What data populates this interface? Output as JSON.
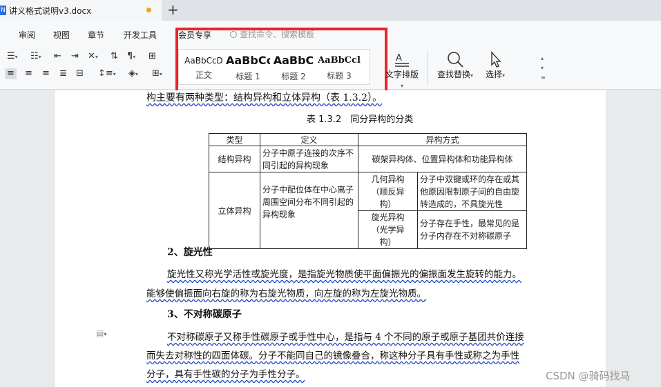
{
  "tab": {
    "icon": "N",
    "title": "讲义格式说明v3.docx"
  },
  "menu": [
    "审阅",
    "视图",
    "章节",
    "开发工具",
    "会员专享"
  ],
  "search_placeholder": "查找命令、搜索模板",
  "styles": [
    {
      "sample": "AaBbCcD",
      "label": "正文"
    },
    {
      "sample": "AaBbCc",
      "label": "标题 1"
    },
    {
      "sample": "AaBbC",
      "label": "标题 2"
    },
    {
      "sample": "AaBbCcl",
      "label": "标题 3"
    }
  ],
  "tools": {
    "text_layout": "文字排版",
    "find_replace": "查找替换",
    "select": "选择"
  },
  "document": {
    "intro_line": "构主要有两种类型：结构异构和立体异构（表 1.3.2）。",
    "table_caption": "表 1.3.2　同分异构的分类",
    "table": {
      "headers": [
        "类型",
        "定义",
        "异构方式"
      ],
      "row1": {
        "type": "结构异构",
        "definition": "分子中原子连接的次序不同引起的异构现象",
        "mode": "碳架异构体、位置异构体和功能异构体"
      },
      "row2": {
        "type": "立体异构",
        "definition": "分子中配位体在中心离子周围空间分布不同引起的异构现象",
        "sub": [
          {
            "name": "几何异构（顺反异构）",
            "desc": "分子中双键或环的存在或其他原因限制原子间的自由旋转造成的，不具旋光性"
          },
          {
            "name": "旋光异构（光学异构）",
            "desc": "分子存在手性，最常见的是分子内存在不对称碳原子"
          }
        ]
      }
    },
    "heading2": "2、旋光性",
    "para2_line1": "旋光性又称光学活性或旋光度，是指旋光物质使平面偏振光的偏振面发生旋转的能力。",
    "para2_line2": "能够使偏振面向右旋的称为右旋光物质，向左旋的称为左旋光物质。",
    "heading3": "3、不对称碳原子",
    "para3_line1": "不对称碳原子又称手性碳原子或手性中心，是指与 4 个不同的原子或原子基团共价连接",
    "para3_line2": "而失去对称性的四面体碳。分子不能同自己的镜像叠合，称这种分子具有手性或称之为手性",
    "para3_line3": "分子，具有手性碳的分子为手性分子。"
  },
  "watermark": "CSDN @骑码找马",
  "colors": {
    "highlight": "#e8242a",
    "accent": "#2f6fe4"
  }
}
